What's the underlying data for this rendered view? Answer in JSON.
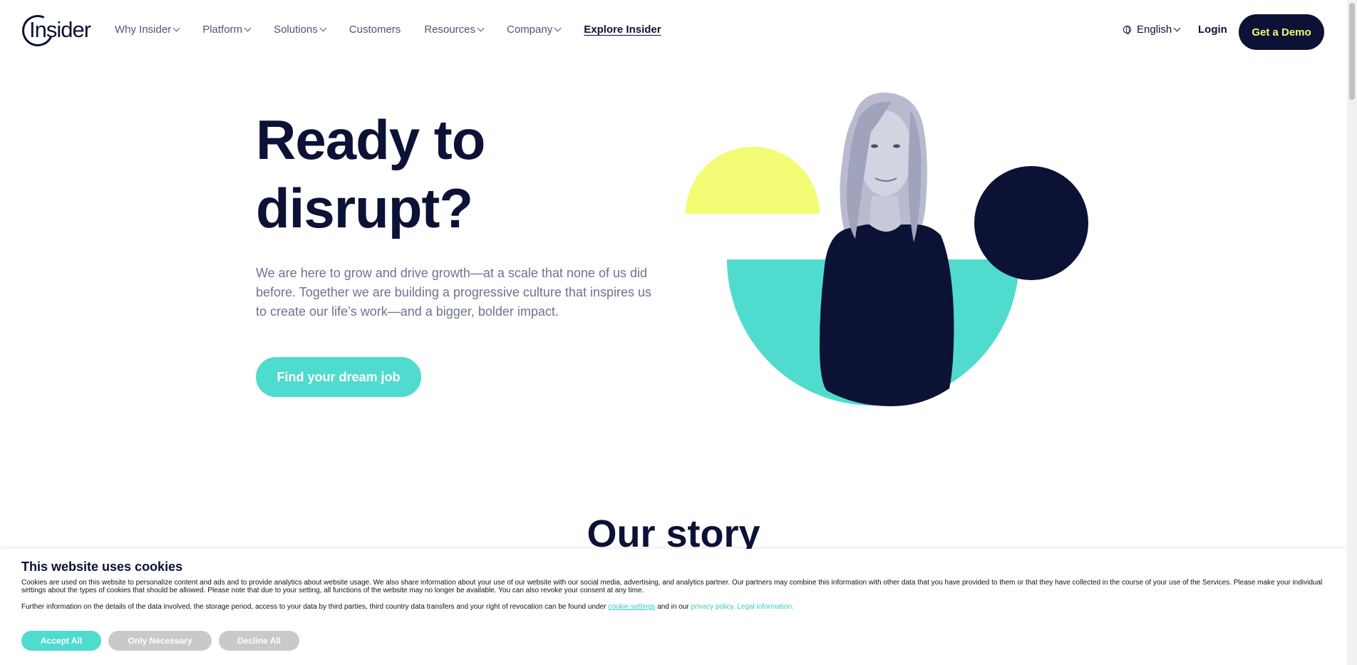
{
  "header": {
    "logo_text": "Insider",
    "nav": [
      {
        "label": "Why Insider",
        "dropdown": true
      },
      {
        "label": "Platform",
        "dropdown": true
      },
      {
        "label": "Solutions",
        "dropdown": true
      },
      {
        "label": "Customers",
        "dropdown": false
      },
      {
        "label": "Resources",
        "dropdown": true
      },
      {
        "label": "Company",
        "dropdown": true
      }
    ],
    "explore": "Explore Insider",
    "language": "English",
    "login": "Login",
    "demo": "Get a Demo"
  },
  "hero": {
    "title_line1": "Ready to",
    "title_line2": "disrupt?",
    "subtitle": "We are here to grow and drive growth—at a scale that none of us did before. Together we are building a progressive culture that inspires us to create our life’s work—and a bigger, bolder impact.",
    "cta": "Find your dream job"
  },
  "story": {
    "title": "Our story"
  },
  "cookie": {
    "title": "This website uses cookies",
    "text": "Cookies are used on this website to personalize content and ads and to provide analytics about website usage. We also share information about your use of our website with our social media, advertising, and analytics partner. Our partners may combine this information with other data that you have provided to them or that they have collected in the course of your use of the Services. Please make your individual settings about the types of cookies that should be allowed. Please note that due to your setting, all functions of the website may no longer be available. You can also revoke your consent at any time.",
    "text2_prefix": "Further information on the details of the data involved, the storage period, access to your data by third parties, third country data transfers and your right of revocation can be found under",
    "settings_link": "cookie settings",
    "and_in_our": "and in our",
    "privacy_link": "privacy policy.",
    "legal_link": "Legal information.",
    "accept": "Accept All",
    "necessary": "Only Necessary",
    "decline": "Decline All"
  },
  "colors": {
    "navy": "#0b1236",
    "teal": "#4fdcce",
    "yellow": "#f4fb74"
  }
}
